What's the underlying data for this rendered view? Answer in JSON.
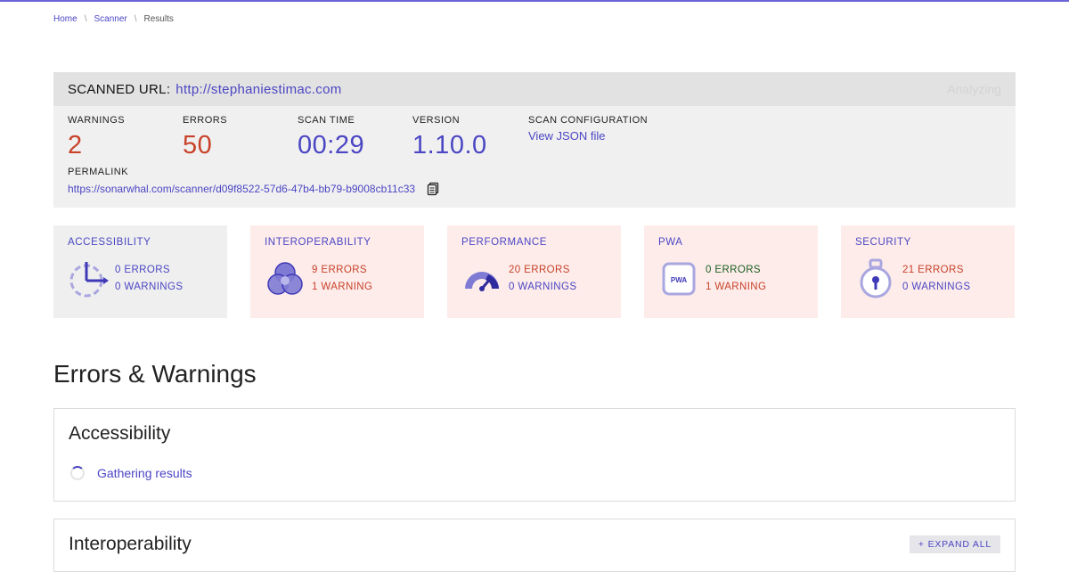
{
  "breadcrumb": [
    "Home",
    "Scanner",
    "Results"
  ],
  "scan": {
    "label": "SCANNED URL:",
    "url": "http://stephaniestimac.com",
    "status": "Analyzing",
    "warnings_label": "WARNINGS",
    "warnings": "2",
    "errors_label": "ERRORS",
    "errors": "50",
    "time_label": "SCAN TIME",
    "time": "00:29",
    "version_label": "VERSION",
    "version": "1.10.0",
    "config_label": "SCAN CONFIGURATION",
    "config_link": "View JSON file",
    "permalink_label": "PERMALINK",
    "permalink": "https://sonarwhal.com/scanner/d09f8522-57d6-47b4-bb79-b9008cb11c33",
    "copy_icon": "copy-icon"
  },
  "categories": [
    {
      "title": "ACCESSIBILITY",
      "errors": "0 ERRORS",
      "warnings": "0 WARNINGS",
      "icon": "accessibility-icon"
    },
    {
      "title": "INTEROPERABILITY",
      "errors": "9 ERRORS",
      "warnings": "1 WARNING",
      "icon": "interoperability-icon"
    },
    {
      "title": "PERFORMANCE",
      "errors": "20 ERRORS",
      "warnings": "0 WARNINGS",
      "icon": "performance-icon"
    },
    {
      "title": "PWA",
      "errors": "0 ERRORS",
      "warnings": "1 WARNING",
      "icon": "pwa-icon",
      "icon_text": "PWA"
    },
    {
      "title": "SECURITY",
      "errors": "21 ERRORS",
      "warnings": "0 WARNINGS",
      "icon": "security-icon"
    }
  ],
  "colors": {
    "accent": "#4b46c3",
    "error": "#c8422a",
    "ok": "#1b5e20",
    "error_bg": "#fdecea",
    "neutral_bg": "#efefef"
  },
  "errors_warnings": {
    "title": "Errors & Warnings",
    "sections": [
      {
        "title": "Accessibility",
        "status": "Gathering results"
      },
      {
        "title": "Interoperability",
        "action": "+ EXPAND ALL"
      }
    ]
  }
}
